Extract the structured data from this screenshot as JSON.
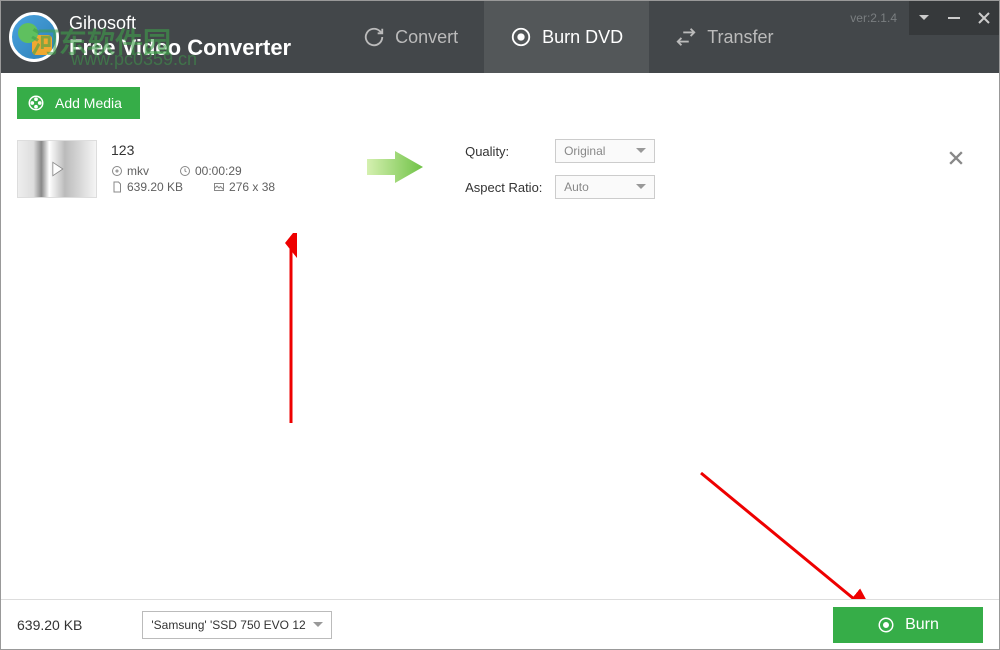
{
  "header": {
    "brand_top": "Gihosoft",
    "brand_bottom": "Free Video Converter",
    "version": "ver:2.1.4",
    "watermark_main": "河东软件园",
    "watermark_sub": "www.pc0359.cn"
  },
  "tabs": {
    "convert": "Convert",
    "burn": "Burn DVD",
    "transfer": "Transfer"
  },
  "toolbar": {
    "add_media": "Add Media"
  },
  "media": {
    "title": "123",
    "format": "mkv",
    "duration": "00:00:29",
    "filesize": "639.20 KB",
    "dimensions": "276 x 38"
  },
  "options": {
    "quality_label": "Quality:",
    "quality_value": "Original",
    "aspect_label": "Aspect Ratio:",
    "aspect_value": "Auto"
  },
  "footer": {
    "total_size": "639.20 KB",
    "device": "'Samsung' 'SSD 750 EVO 12",
    "burn_label": "Burn"
  }
}
